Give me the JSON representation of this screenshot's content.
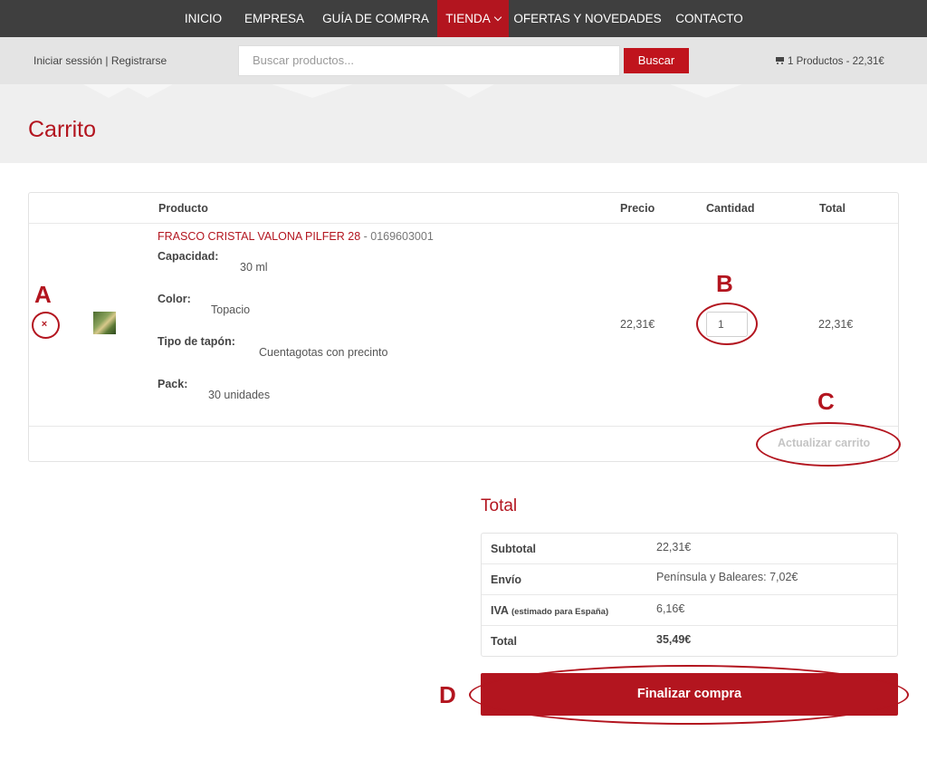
{
  "nav": {
    "items": [
      {
        "label": "INICIO"
      },
      {
        "label": "EMPRESA"
      },
      {
        "label": "GUÍA DE COMPRA"
      },
      {
        "label": "TIENDA"
      },
      {
        "label": "OFERTAS Y NOVEDADES"
      },
      {
        "label": "CONTACTO"
      }
    ]
  },
  "account": {
    "login": "Iniciar sessión",
    "separator": "|",
    "register": "Registrarse"
  },
  "search": {
    "placeholder": "Buscar productos...",
    "button": "Buscar"
  },
  "cart_summary": {
    "text": "1 Productos - 22,31€"
  },
  "page": {
    "title": "Carrito"
  },
  "cart": {
    "headers": {
      "product": "Producto",
      "price": "Precio",
      "quantity": "Cantidad",
      "total": "Total"
    },
    "item": {
      "name": "FRASCO CRISTAL VALONA PILFER 28",
      "sku": " - 0169603001",
      "attributes": [
        {
          "label": "Capacidad:",
          "value": "30 ml"
        },
        {
          "label": "Color:",
          "value": "Topacio"
        },
        {
          "label": "Tipo de tapón:",
          "value": "Cuentagotas con precinto"
        },
        {
          "label": "Pack:",
          "value": "30 unidades"
        }
      ],
      "price": "22,31€",
      "quantity": "1",
      "total": "22,31€"
    },
    "remove_icon": "×",
    "update_button": "Actualizar carrito"
  },
  "totals": {
    "title": "Total",
    "rows": [
      {
        "label": "Subtotal",
        "note": "",
        "value": "22,31€"
      },
      {
        "label": "Envío",
        "note": "",
        "value": "Península y Baleares: 7,02€"
      },
      {
        "label": "IVA",
        "note": "(estimado para España)",
        "value": "6,16€"
      },
      {
        "label": "Total",
        "note": "",
        "value": "35,49€"
      }
    ]
  },
  "checkout": {
    "button": "Finalizar compra"
  },
  "annotations": {
    "a": "A",
    "b": "B",
    "c": "C",
    "d": "D"
  },
  "colors": {
    "brand": "#b3151f",
    "nav_bg": "#3f3f3f",
    "subbar_bg": "#e4e4e4",
    "titlebar_bg": "#efefef"
  }
}
